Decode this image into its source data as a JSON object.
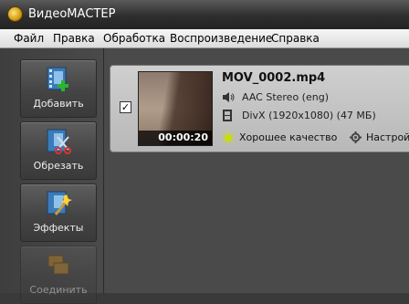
{
  "window": {
    "title": "ВидеоМАСТЕР"
  },
  "menu": {
    "items": [
      "Файл",
      "Правка",
      "Обработка",
      "Воспроизведение",
      "Справка"
    ]
  },
  "sidebar": {
    "items": [
      {
        "label": "Добавить",
        "icon": "add-video-icon"
      },
      {
        "label": "Обрезать",
        "icon": "cut-video-icon"
      },
      {
        "label": "Эффекты",
        "icon": "effects-wand-icon"
      },
      {
        "label": "Соединить",
        "icon": "join-video-icon"
      }
    ]
  },
  "file": {
    "checked": true,
    "name": "MOV_0002.mp4",
    "duration": "00:00:20",
    "audio": "AAC Stereo (eng)",
    "video": "DivX (1920x1080) (47 МБ)",
    "quality": "Хорошее качество",
    "settings": "Настройки"
  },
  "colors": {
    "titlebar": "#2e2e2e",
    "menubar": "#e8e8e8",
    "sidebar": "#444444",
    "main": "#4a4a4a",
    "card": "#c4c4c4"
  }
}
